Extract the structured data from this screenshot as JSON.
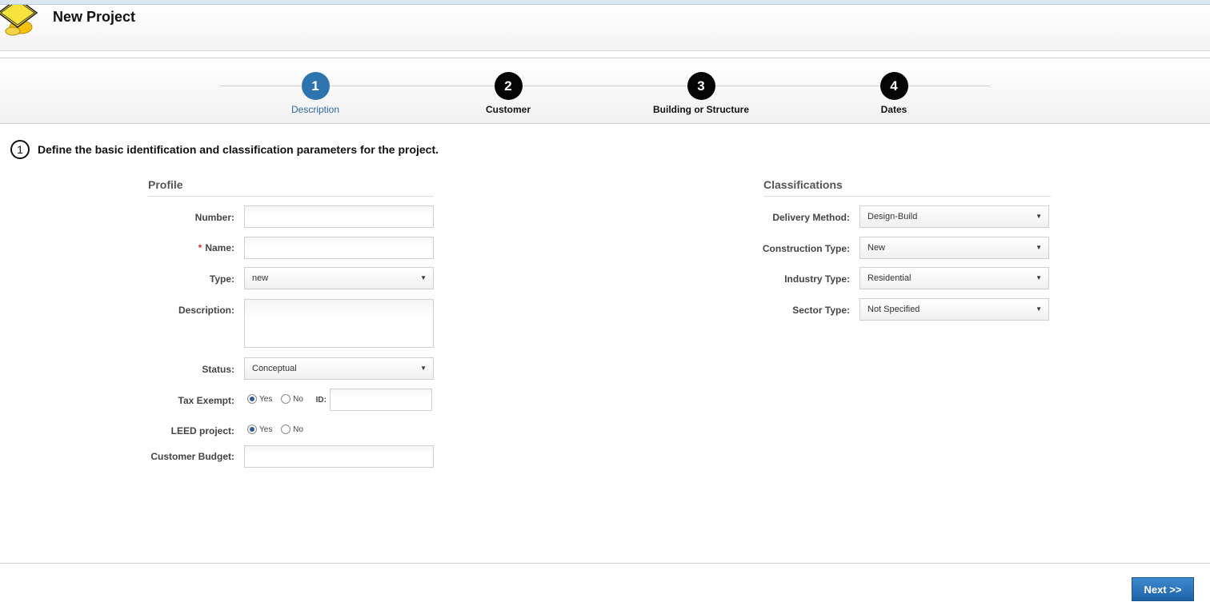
{
  "header": {
    "title": "New Project",
    "logo_text": "UNDER CONSTRUCTION"
  },
  "wizard": {
    "steps": [
      {
        "number": "1",
        "label": "Description"
      },
      {
        "number": "2",
        "label": "Customer"
      },
      {
        "number": "3",
        "label": "Building or Structure"
      },
      {
        "number": "4",
        "label": "Dates"
      }
    ],
    "active_step": 1
  },
  "intro": {
    "number": "1",
    "text": "Define the basic identification and classification parameters for the project."
  },
  "profile": {
    "title": "Profile",
    "number_label": "Number:",
    "number_value": "",
    "name_required": "*",
    "name_label": "Name:",
    "name_value": "",
    "type_label": "Type:",
    "type_value": "new",
    "description_label": "Description:",
    "description_value": "",
    "status_label": "Status:",
    "status_value": "Conceptual",
    "tax_exempt_label": "Tax Exempt:",
    "tax_exempt_yes": "Yes",
    "tax_exempt_no": "No",
    "tax_exempt_selected": "Yes",
    "id_label": "ID:",
    "id_value": "",
    "leed_label": "LEED project:",
    "leed_yes": "Yes",
    "leed_no": "No",
    "leed_selected": "Yes",
    "budget_label": "Customer Budget:",
    "budget_value": ""
  },
  "classifications": {
    "title": "Classifications",
    "delivery_label": "Delivery Method:",
    "delivery_value": "Design-Build",
    "construction_label": "Construction Type:",
    "construction_value": "New",
    "industry_label": "Industry Type:",
    "industry_value": "Residential",
    "sector_label": "Sector Type:",
    "sector_value": "Not Specified"
  },
  "footer": {
    "next_label": "Next >>"
  },
  "colors": {
    "accent": "#2d73ae",
    "step_inactive": "#050505",
    "button": "#2a72bb",
    "required": "#c0392b"
  },
  "icons": {
    "dropdown": "triangle-down",
    "logo": "under-construction-sign"
  }
}
